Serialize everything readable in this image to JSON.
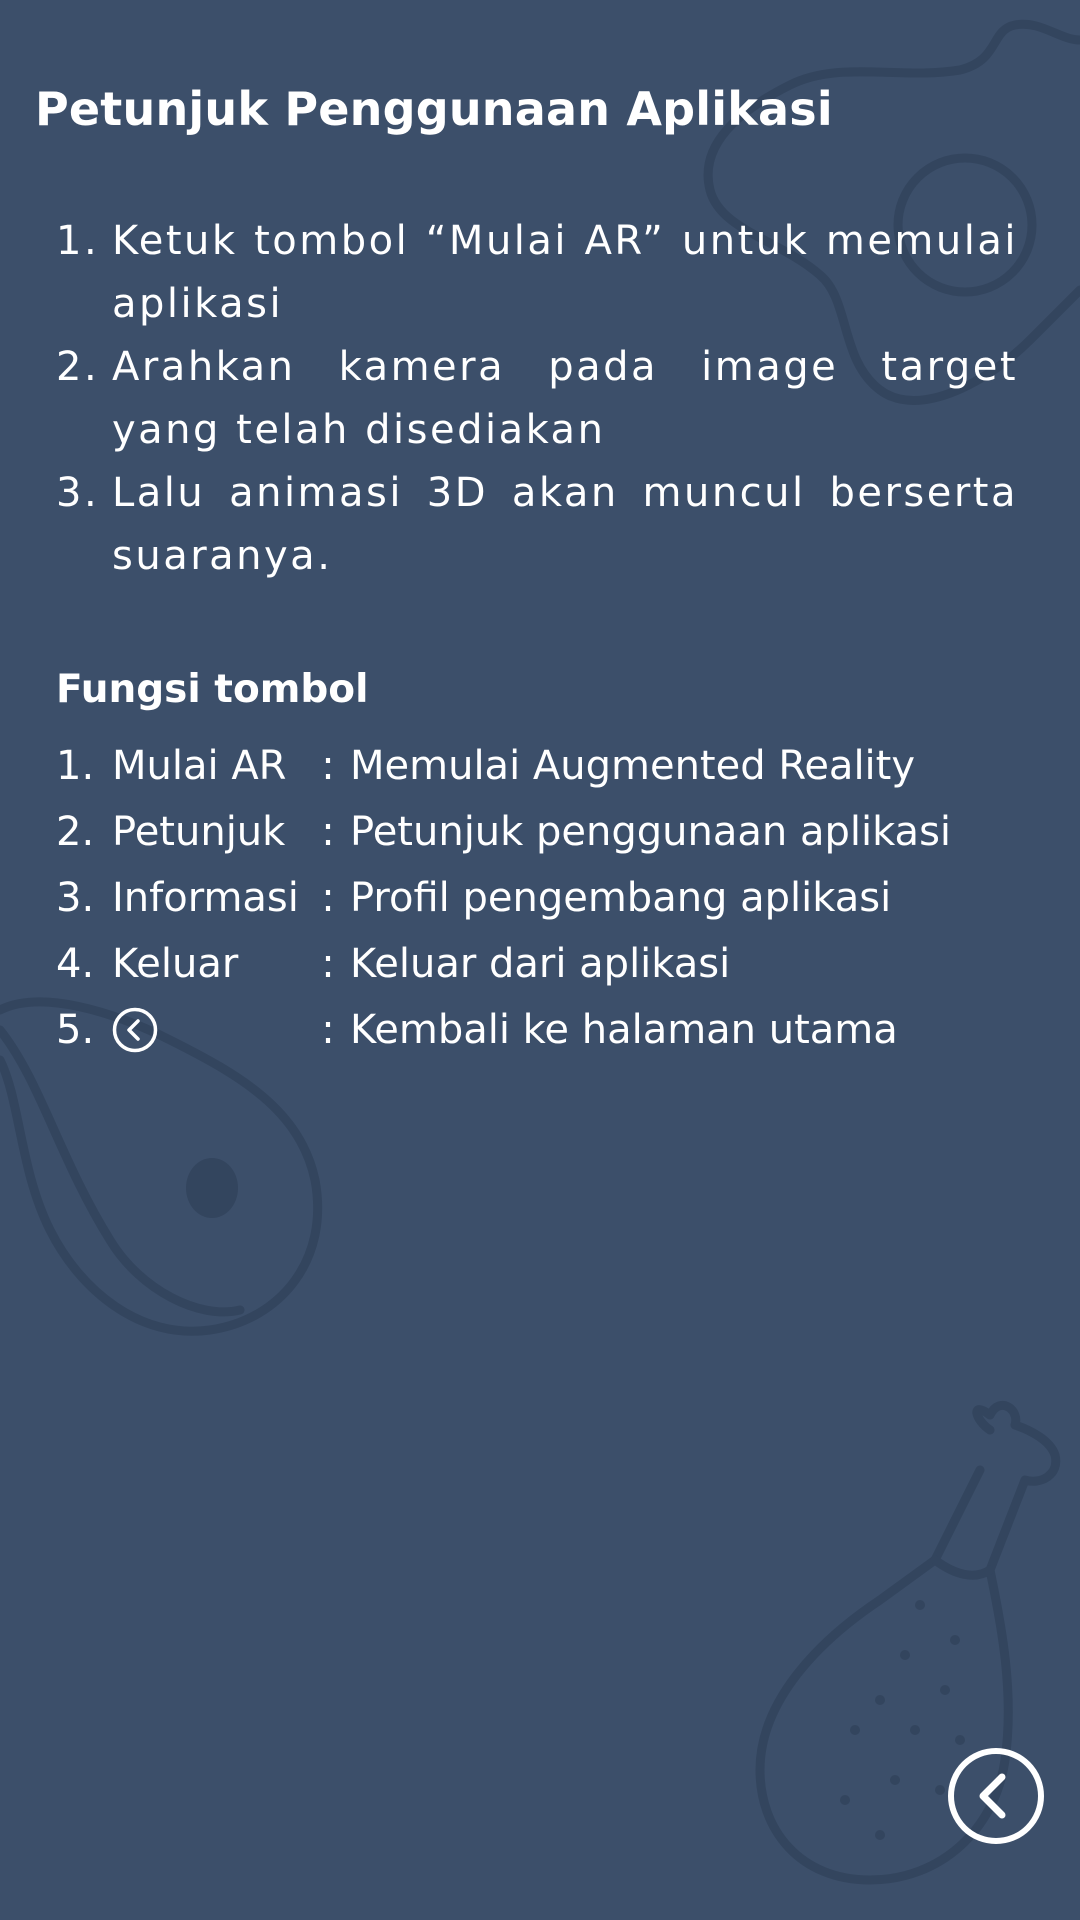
{
  "header": {
    "title": "Petunjuk Penggunaan Aplikasi"
  },
  "steps": [
    {
      "num": "1.",
      "text": "Ketuk tombol “Mulai AR” untuk memulai aplikasi"
    },
    {
      "num": "2.",
      "text": "Arahkan kamera pada image target yang telah disediakan"
    },
    {
      "num": "3.",
      "text": "Lalu animasi 3D akan muncul berserta suaranya."
    }
  ],
  "functions": {
    "title": "Fungsi tombol",
    "separator": ":",
    "items": [
      {
        "num": "1.",
        "name": "Mulai AR",
        "desc": "Memulai Augmented Reality"
      },
      {
        "num": "2.",
        "name": "Petunjuk",
        "desc": "Petunjuk penggunaan aplikasi"
      },
      {
        "num": "3.",
        "name": "Informasi",
        "desc": "Profil pengembang aplikasi"
      },
      {
        "num": "4.",
        "name": "Keluar",
        "desc": "Keluar dari aplikasi"
      },
      {
        "num": "5.",
        "icon": "back-circle-icon",
        "desc": "Kembali ke halaman utama"
      }
    ]
  },
  "navigation": {
    "back_icon": "back-circle-icon"
  },
  "colors": {
    "background": "#3c4f6a",
    "decoration": "#34465f",
    "text": "#ffffff"
  }
}
